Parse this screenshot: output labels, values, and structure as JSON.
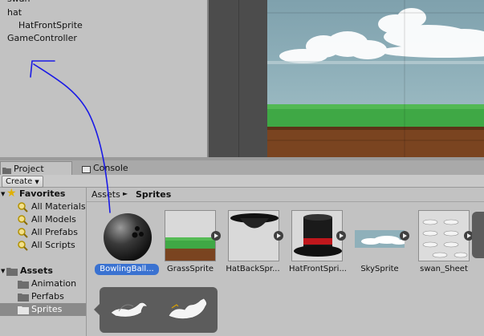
{
  "hierarchy": {
    "items": [
      "swan",
      "hat",
      "HatFrontSprite",
      "GameController"
    ]
  },
  "tabs": {
    "project": "Project",
    "console": "Console"
  },
  "toolbar": {
    "create_label": "Create"
  },
  "tree": {
    "favorites_label": "Favorites",
    "favorites": [
      "All Materials",
      "All Models",
      "All Prefabs",
      "All Scripts"
    ],
    "assets_label": "Assets",
    "folders": [
      "Animation",
      "Perfabs",
      "Sprites"
    ],
    "selected_folder": "Sprites"
  },
  "breadcrumb": {
    "root": "Assets",
    "separator": "►",
    "current": "Sprites"
  },
  "assets": [
    {
      "label": "BowlingBall...",
      "icon": "bowling-ball",
      "selected": true
    },
    {
      "label": "GrassSprite",
      "icon": "grass",
      "selected": false
    },
    {
      "label": "HatBackSpr...",
      "icon": "hat-back",
      "selected": false
    },
    {
      "label": "HatFrontSpri...",
      "icon": "hat-front",
      "selected": false
    },
    {
      "label": "SkySprite",
      "icon": "sky",
      "selected": false
    },
    {
      "label": "swan_Sheet",
      "icon": "swan-sheet",
      "selected": false
    }
  ],
  "popup": {
    "frames": [
      "swan-frame-1",
      "swan-frame-2"
    ]
  },
  "colors": {
    "selection": "#3a72d1",
    "annotation": "#1a1ae6",
    "grass": "#3fa845",
    "dirt": "#7a4420",
    "sky": "#8fb0ba"
  }
}
